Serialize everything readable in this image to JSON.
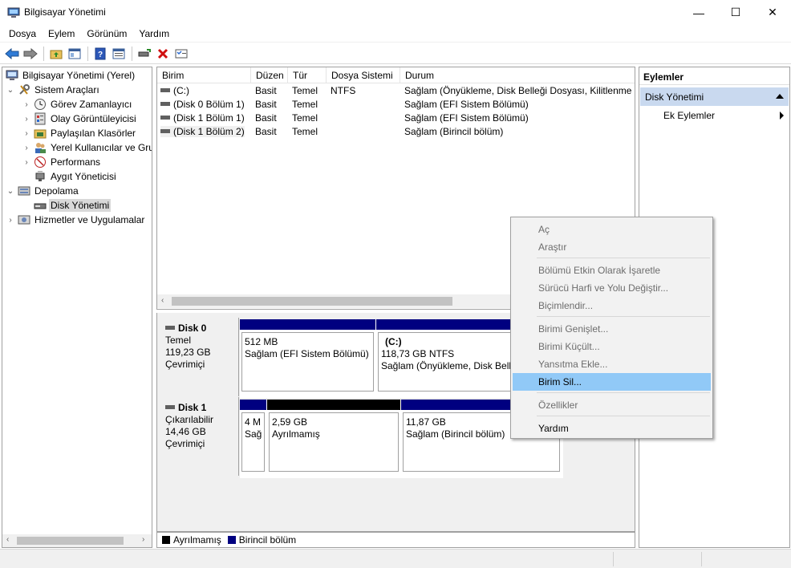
{
  "window": {
    "title": "Bilgisayar Yönetimi",
    "minimize": "—",
    "maximize": "☐",
    "close": "✕"
  },
  "menu": [
    "Dosya",
    "Eylem",
    "Görünüm",
    "Yardım"
  ],
  "tree": {
    "root": "Bilgisayar Yönetimi (Yerel)",
    "system_tools": "Sistem Araçları",
    "task_scheduler": "Görev Zamanlayıcı",
    "event_viewer": "Olay Görüntüleyicisi",
    "shared_folders": "Paylaşılan Klasörler",
    "local_users": "Yerel Kullanıcılar ve Gruplar",
    "performance": "Performans",
    "device_manager": "Aygıt Yöneticisi",
    "storage": "Depolama",
    "disk_management": "Disk Yönetimi",
    "services": "Hizmetler ve Uygulamalar"
  },
  "volume_list": {
    "columns": [
      "Birim",
      "Düzen",
      "Tür",
      "Dosya Sistemi",
      "Durum"
    ],
    "rows": [
      [
        "(C:)",
        "Basit",
        "Temel",
        "NTFS",
        "Sağlam (Önyükleme, Disk Belleği Dosyası, Kilitlenme"
      ],
      [
        "(Disk 0 Bölüm 1)",
        "Basit",
        "Temel",
        "",
        "Sağlam (EFI Sistem Bölümü)"
      ],
      [
        "(Disk 1 Bölüm 1)",
        "Basit",
        "Temel",
        "",
        "Sağlam (EFI Sistem Bölümü)"
      ],
      [
        "(Disk 1 Bölüm 2)",
        "Basit",
        "Temel",
        "",
        "Sağlam (Birincil bölüm)"
      ]
    ]
  },
  "disks": {
    "disk0": {
      "name": "Disk 0",
      "type": "Temel",
      "size": "119,23 GB",
      "state": "Çevrimiçi",
      "p1_size": "512 MB",
      "p1_status": "Sağlam (EFI Sistem Bölümü)",
      "p2_name": "(C:)",
      "p2_size": "118,73 GB NTFS",
      "p2_status": "Sağlam (Önyükleme, Disk Belleği Dosyası, Kilitlenme"
    },
    "disk1": {
      "name": "Disk 1",
      "type": "Çıkarılabilir",
      "size": "14,46 GB",
      "state": "Çevrimiçi",
      "p1_size": "4 M",
      "p1_status": "Sağ",
      "p2_size": "2,59 GB",
      "p2_status": "Ayrılmamış",
      "p3_size": "11,87 GB",
      "p3_status": "Sağlam (Birincil bölüm)"
    }
  },
  "legend": {
    "unallocated": "Ayrılmamış",
    "primary": "Birincil bölüm"
  },
  "actions": {
    "title": "Eylemler",
    "section": "Disk Yönetimi",
    "more": "Ek Eylemler"
  },
  "context_menu": {
    "open": "Aç",
    "explore": "Araştır",
    "mark_active": "Bölümü Etkin Olarak İşaretle",
    "change_letter": "Sürücü Harfi ve Yolu Değiştir...",
    "format": "Biçimlendir...",
    "extend": "Birimi Genişlet...",
    "shrink": "Birimi Küçült...",
    "add_mirror": "Yansıtma Ekle...",
    "delete": "Birim Sil...",
    "properties": "Özellikler",
    "help": "Yardım"
  },
  "colors": {
    "primary_partition": "#000080",
    "unallocated": "#000000",
    "selection": "#91c9f7",
    "actions_header": "#c9d9ef"
  }
}
